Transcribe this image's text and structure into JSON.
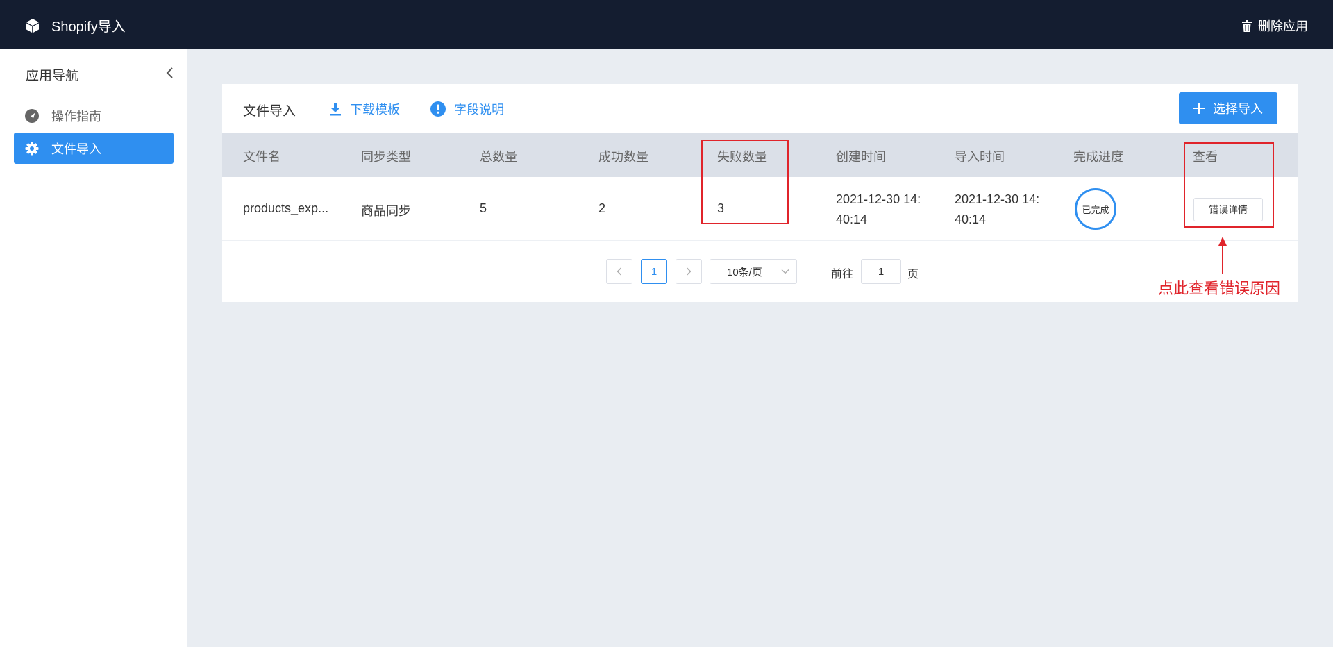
{
  "topbar": {
    "app_title": "Shopify导入",
    "delete_label": "删除应用"
  },
  "sidebar": {
    "title": "应用导航",
    "items": [
      {
        "label": "操作指南",
        "icon": "navigation-icon"
      },
      {
        "label": "文件导入",
        "icon": "gear-icon",
        "active": true
      }
    ]
  },
  "card": {
    "title": "文件导入",
    "download_label": "下载模板",
    "fields_label": "字段说明",
    "select_import_label": "选择导入"
  },
  "table": {
    "columns": [
      "文件名",
      "同步类型",
      "总数量",
      "成功数量",
      "失败数量",
      "创建时间",
      "导入时间",
      "完成进度",
      "查看"
    ],
    "rows": [
      {
        "file_name": "products_exp...",
        "sync_type": "商品同步",
        "total": "5",
        "success": "2",
        "failed": "3",
        "created_line1": "2021-12-30 14:",
        "created_line2": "40:14",
        "imported_line1": "2021-12-30 14:",
        "imported_line2": "40:14",
        "progress": "已完成",
        "action": "错误详情"
      }
    ]
  },
  "pagination": {
    "current_page": "1",
    "page_size": "10条/页",
    "goto_prefix": "前往",
    "goto_value": "1",
    "goto_suffix": "页"
  },
  "annotation": {
    "hint": "点此查看错误原因"
  },
  "colors": {
    "primary": "#2f8ff0",
    "topbar": "#141d30",
    "highlight": "#e0242b"
  }
}
